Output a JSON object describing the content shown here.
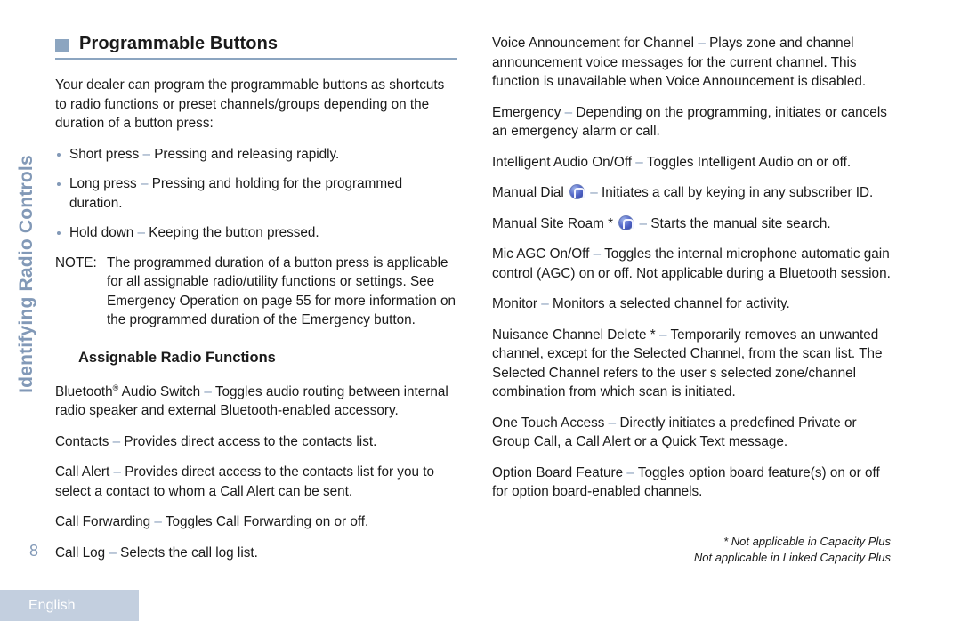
{
  "side_tab": {
    "label": "Identifying Radio Controls"
  },
  "page_number": "8",
  "language_tab": {
    "label": "English"
  },
  "left_column": {
    "heading": "Programmable Buttons",
    "intro": "Your dealer can program the programmable buttons as shortcuts to radio functions  or preset channels/groups depending on the duration of a button press:",
    "bullets": [
      {
        "term": "Short press",
        "dash": "–",
        "text": "Pressing and releasing rapidly."
      },
      {
        "term": "Long press",
        "dash": "–",
        "text": "Pressing and holding for the programmed duration."
      },
      {
        "term": "Hold down",
        "dash": "–",
        "text": "Keeping the button pressed."
      }
    ],
    "note": {
      "label": "NOTE:",
      "text": "The programmed duration of a button press is applicable for all assignable radio/utility functions or settings. See Emergency Operation  on page 55 for more information on the programmed duration of the Emergency  button."
    },
    "subheading": "Assignable Radio Functions",
    "entries": [
      {
        "term": "Bluetooth",
        "sup": "®",
        "term_cont": " Audio Switch",
        "dash": "–",
        "text": "Toggles audio routing between internal radio speaker and external Bluetooth-enabled accessory."
      },
      {
        "term": "Contacts",
        "dash": "–",
        "text": "Provides direct access to the contacts list."
      },
      {
        "term": "Call Alert",
        "dash": "–",
        "text": "Provides direct access to the contacts list for you to select a contact to whom a Call Alert can be sent."
      },
      {
        "term": "Call Forwarding",
        "dash": "–",
        "text": "Toggles Call Forwarding on or off."
      },
      {
        "term": "Call Log",
        "dash": "–",
        "text": "Selects the call log list."
      }
    ]
  },
  "right_column": {
    "entries": [
      {
        "term": "Voice Announcement for Channel",
        "dash": "–",
        "text": "Plays zone and channel announcement voice messages for the current channel. This function is unavailable when Voice Announcement is disabled."
      },
      {
        "term": "Emergency",
        "dash": "–",
        "text": "Depending on the programming, initiates or cancels an emergency alarm or call."
      },
      {
        "term": "Intelligent Audio On/Off",
        "dash": "–",
        "text": "Toggles Intelligent Audio on or off."
      },
      {
        "term": "Manual Dial",
        "icon": "radio-button-icon",
        "dash": "–",
        "text": "Initiates a call by keying in any subscriber ID."
      },
      {
        "term": "Manual Site Roam",
        "star": "*",
        "icon": "radio-button-icon",
        "dash": "–",
        "text": "Starts the manual site search."
      },
      {
        "term": "Mic AGC On/Off",
        "dash": "–",
        "text": "Toggles the internal microphone automatic gain control (AGC) on or off. Not applicable during a Bluetooth session."
      },
      {
        "term": "Monitor",
        "dash": "–",
        "text": "Monitors a selected channel for activity."
      },
      {
        "term": "Nuisance Channel Delete",
        "star": "*",
        "dash": "–",
        "text": "Temporarily removes an unwanted channel, except for the Selected Channel, from the scan list. The Selected Channel refers to the user s selected zone/channel combination from which scan is initiated."
      },
      {
        "term": "One Touch Access",
        "dash": "–",
        "text": "Directly initiates a predefined Private or Group Call, a Call Alert or a Quick Text message."
      },
      {
        "term": "Option Board Feature",
        "dash": "–",
        "text": "Toggles option board feature(s) on or off for option board-enabled channels."
      }
    ]
  },
  "footnotes": {
    "line1": "* Not applicable in Capacity Plus",
    "line2": "Not applicable in Linked Capacity Plus"
  },
  "colors": {
    "accent": "#8ca5c0",
    "side_text": "#8299b7",
    "tab_bg": "#c3cfdf",
    "body_text": "#1a1a1a"
  }
}
